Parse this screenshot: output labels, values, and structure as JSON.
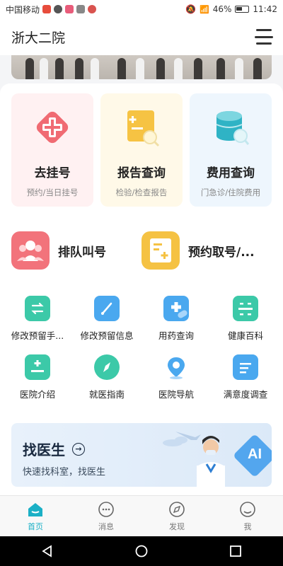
{
  "status_bar": {
    "carrier": "中国移动",
    "battery": "46%",
    "time": "11:42"
  },
  "header": {
    "title": "浙大二院",
    "menu_icon": "menu-icon"
  },
  "tiles": [
    {
      "label": "去挂号",
      "sub": "预约/当日挂号",
      "icon": "plus-cross-icon"
    },
    {
      "label": "报告查询",
      "sub": "检验/检查报告",
      "icon": "report-search-icon"
    },
    {
      "label": "费用查询",
      "sub": "门急诊/住院费用",
      "icon": "database-search-icon"
    }
  ],
  "wide_items": [
    {
      "label": "排队叫号",
      "icon": "queue-people-icon"
    },
    {
      "label": "预约取号/...",
      "icon": "appointment-ticket-icon"
    }
  ],
  "grid_items": [
    {
      "label": "修改预留手...",
      "icon": "phone-swap-icon"
    },
    {
      "label": "修改预留信息",
      "icon": "edit-info-icon"
    },
    {
      "label": "用药查询",
      "icon": "medicine-icon"
    },
    {
      "label": "健康百科",
      "icon": "encyclopedia-icon"
    },
    {
      "label": "医院介绍",
      "icon": "hospital-building-icon"
    },
    {
      "label": "就医指南",
      "icon": "compass-icon"
    },
    {
      "label": "医院导航",
      "icon": "location-pin-icon"
    },
    {
      "label": "满意度调查",
      "icon": "survey-icon"
    }
  ],
  "doctor_card": {
    "title": "找医生",
    "subtitle": "快速找科室，找医生",
    "badge": "AI"
  },
  "tabs": [
    {
      "label": "首页",
      "icon": "home-icon",
      "active": true
    },
    {
      "label": "消息",
      "icon": "message-icon",
      "active": false
    },
    {
      "label": "发现",
      "icon": "discover-icon",
      "active": false
    },
    {
      "label": "我",
      "icon": "profile-icon",
      "active": false
    }
  ],
  "colors": {
    "accent": "#1bb0c6",
    "tile_pink": "#fff1f2",
    "tile_yellow": "#fff9e8",
    "tile_blue": "#eef6fd"
  }
}
